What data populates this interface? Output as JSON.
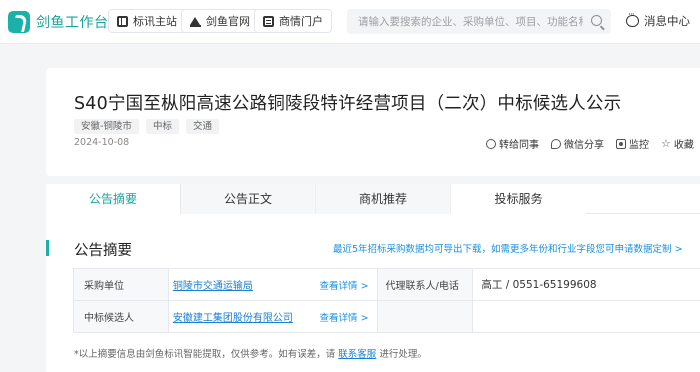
{
  "header": {
    "logo_text": "剑鱼工作台",
    "nav": [
      {
        "label": "标讯主站",
        "icon": "book-icon"
      },
      {
        "label": "剑鱼官网",
        "icon": "crown-icon"
      },
      {
        "label": "商情门户",
        "icon": "document-icon"
      }
    ],
    "search": {
      "placeholder": "请输入要搜索的企业、采购单位、项目、功能名称",
      "value": ""
    },
    "message_label": "消息中心"
  },
  "notice": {
    "title": "S40宁国至枞阳高速公路铜陵段特许经营项目（二次）中标候选人公示",
    "tags": [
      "安徽-铜陵市",
      "中标",
      "交通"
    ],
    "date": "2024-10-08",
    "actions": [
      {
        "label": "转给同事",
        "icon": "share-icon"
      },
      {
        "label": "微信分享",
        "icon": "wechat-icon"
      },
      {
        "label": "监控",
        "icon": "monitor-icon"
      },
      {
        "label": "收藏",
        "icon": "star-icon"
      }
    ]
  },
  "tabs": [
    {
      "label": "公告摘要",
      "active": true
    },
    {
      "label": "公告正文",
      "active": false
    },
    {
      "label": "商机推荐",
      "active": false
    },
    {
      "label": "投标服务",
      "active": false
    }
  ],
  "summary": {
    "title": "公告摘要",
    "export_link": "最近5年招标采购数据均可导出下载，如需更多年份和行业字段您可申请数据定制 >",
    "rows": [
      {
        "label": "采购单位",
        "value": "铜陵市交通运输局",
        "detail": "查看详情 >",
        "label2": "代理联系人/电话",
        "value2": "高工 / 0551-65199608"
      },
      {
        "label": "中标候选人",
        "value": "安徽建工集团股份有限公司",
        "detail": "查看详情 >",
        "label2": "",
        "value2": ""
      }
    ],
    "note_prefix": "*以上摘要信息由剑鱼标讯智能提取，仅供参考。如有误差，请",
    "note_link": "联系客服",
    "note_suffix": "进行处理。"
  },
  "colors": {
    "accent": "#1bb0a8",
    "link": "#1a7fd4"
  }
}
